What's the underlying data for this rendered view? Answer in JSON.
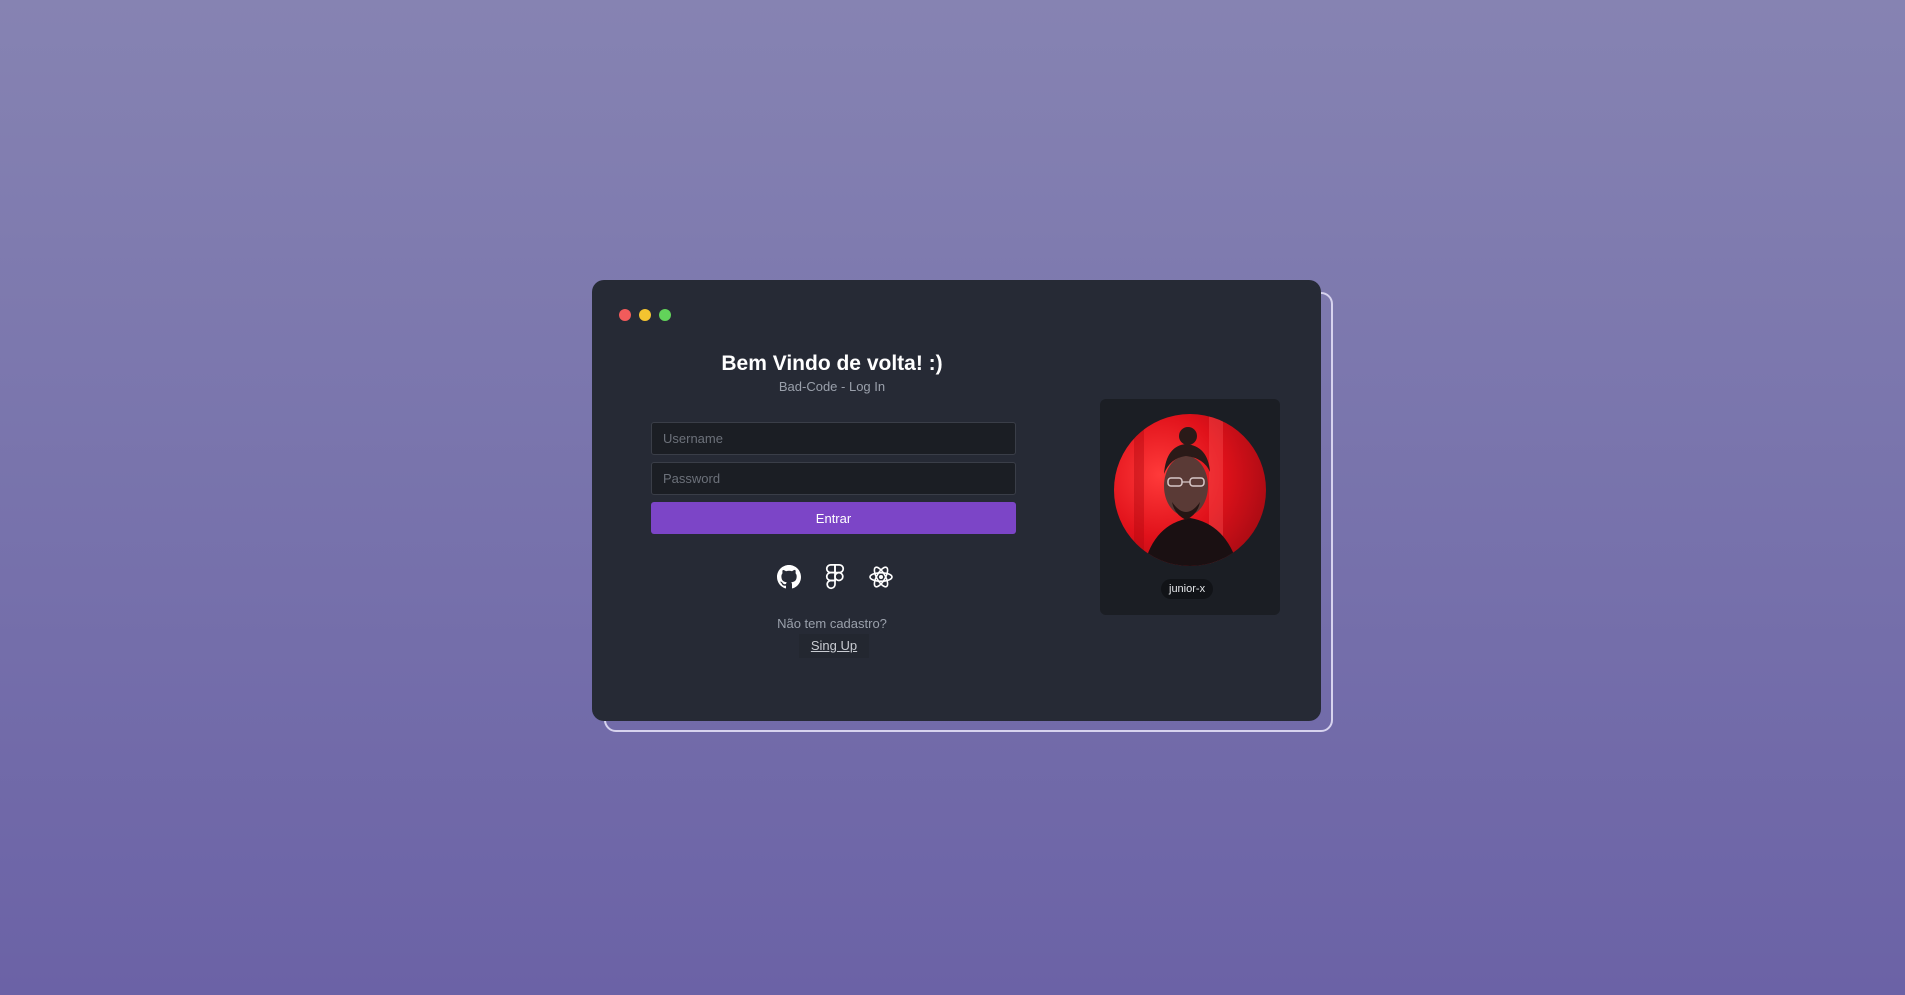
{
  "window": {
    "controls": [
      "close",
      "minimize",
      "maximize"
    ]
  },
  "login": {
    "title": "Bem Vindo de volta! :)",
    "subtitle": "Bad-Code - Log In",
    "username_placeholder": "Username",
    "password_placeholder": "Password",
    "submit_label": "Entrar"
  },
  "social": [
    {
      "icon": "github-icon"
    },
    {
      "icon": "figma-icon"
    },
    {
      "icon": "react-icon"
    }
  ],
  "signup": {
    "prompt": "Não tem cadastro?",
    "link_label": "Sing Up"
  },
  "profile": {
    "username": "junior-x"
  },
  "colors": {
    "accent": "#7c45c7",
    "window_bg": "#262a35",
    "close": "#f25b5b",
    "minimize": "#f4c430",
    "maximize": "#62d35a"
  }
}
